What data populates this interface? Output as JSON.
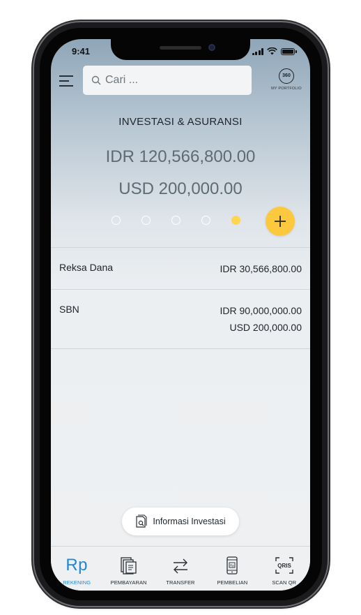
{
  "status_bar": {
    "time": "9:41"
  },
  "search": {
    "placeholder": "Cari ..."
  },
  "portfolio": {
    "badge": "360",
    "label": "MY PORTFOLIO"
  },
  "header": {
    "title": "INVESTASI & ASURANSI",
    "amount_idr": "IDR 120,566,800.00",
    "amount_usd": "USD 200,000.00",
    "carousel": {
      "total_pages": 5,
      "active_page": 5
    }
  },
  "investments": [
    {
      "name": "Reksa Dana",
      "values": [
        "IDR 30,566,800.00"
      ]
    },
    {
      "name": "SBN",
      "values": [
        "IDR 90,000,000.00",
        "USD 200,000.00"
      ]
    }
  ],
  "info_button": {
    "label": "Informasi Investasi"
  },
  "bottom_nav": [
    {
      "icon": "rp-icon",
      "label": "REKENING",
      "active": true
    },
    {
      "icon": "payment-icon",
      "label": "PEMBAYARAN",
      "active": false
    },
    {
      "icon": "transfer-icon",
      "label": "TRANSFER",
      "active": false
    },
    {
      "icon": "purchase-icon",
      "label": "PEMBELIAN",
      "active": false
    },
    {
      "icon": "qris-icon",
      "label": "SCAN QR",
      "active": false
    }
  ],
  "colors": {
    "accent": "#1e88d6",
    "add_button": "#fcc93e",
    "active_dot": "#fdd54f"
  },
  "rp_text": "Rp",
  "qris_text": "QRIS"
}
